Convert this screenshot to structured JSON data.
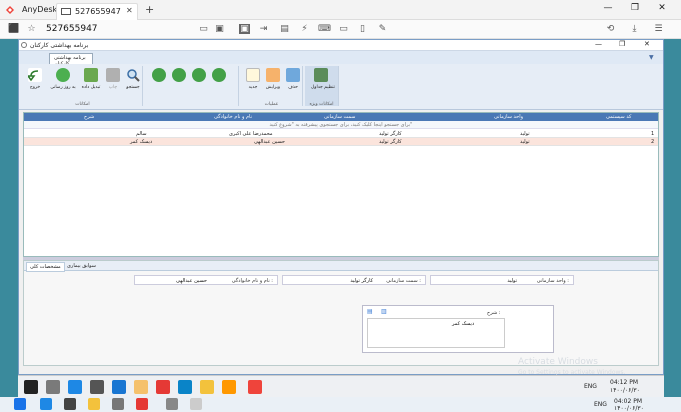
{
  "anydesk": {
    "app_name": "AnyDesk",
    "tab_label": "527655947",
    "address_value": "527655947",
    "colors": {
      "brand": "#ef443b"
    }
  },
  "app": {
    "window_title": "برنامه بهداشتی کارکنان",
    "tab_label": "برنامه بهداشتی کارکنان",
    "ribbon": {
      "buttons": [
        {
          "icon": "exit-icon",
          "label": "خروج"
        },
        {
          "icon": "refresh-icon",
          "label": "به روز رسانی"
        },
        {
          "icon": "convert-icon",
          "label": "تبدیل داده"
        },
        {
          "icon": "print-icon",
          "label": "چاپ"
        },
        {
          "icon": "search-icon",
          "label": "جستجو"
        },
        {
          "icon": "nav-first-icon",
          "label": ""
        },
        {
          "icon": "nav-prev-icon",
          "label": ""
        },
        {
          "icon": "nav-next-icon",
          "label": ""
        },
        {
          "icon": "nav-last-icon",
          "label": ""
        },
        {
          "icon": "new-icon",
          "label": "جدید"
        },
        {
          "icon": "edit-icon",
          "label": "ویرایش"
        },
        {
          "icon": "delete-icon",
          "label": "حذف"
        },
        {
          "icon": "screen-settings-icon",
          "label": "تنظیم جداول"
        }
      ],
      "group_labels": [
        "امکانات",
        "عملیات",
        "امکانات ویژه"
      ]
    },
    "grid": {
      "headers": [
        "کد سیستمی",
        "واحد سازمانی",
        "سمت سازمانی",
        "نام و نام خانوادگی",
        "شرح"
      ],
      "filter_hint": "برای جستجو اینجا کلیک کنید، برای جستجوی پیشرفته به \"شروع کنید\"",
      "rows": [
        {
          "num": "1",
          "unit": "تولید",
          "position": "کارگر تولید",
          "name": "محمدرضا علی اکبری",
          "desc": "سالم"
        },
        {
          "num": "2",
          "unit": "تولید",
          "position": "کارگر تولید",
          "name": "حسین عبدالهی",
          "desc": "دیسک کمر"
        }
      ]
    },
    "detail": {
      "tabs": [
        "مشخصات کلی",
        "سوابق بیماری"
      ],
      "fields": {
        "unit_label": "واحد سازمانی :",
        "unit_value": "تولید",
        "position_label": "سمت سازمانی :",
        "position_value": "کارگر تولید",
        "name_label": "نام و نام خانوادگی :",
        "name_value": "حسین عبدالهی",
        "desc_label": "شرح :",
        "desc_value": "دیسک کمر"
      }
    }
  },
  "watermark": {
    "line1": "Activate Windows",
    "line2": "Go to Settings to activate Windows."
  },
  "inner_taskbar": {
    "lang": "ENG",
    "time": "04:12 PM",
    "date": "۱۴۰۰/۰۶/۳۰"
  },
  "outer_taskbar": {
    "lang": "ENG",
    "time": "04:02 PM",
    "date": "۱۴۰۰/۰۶/۳۰"
  }
}
